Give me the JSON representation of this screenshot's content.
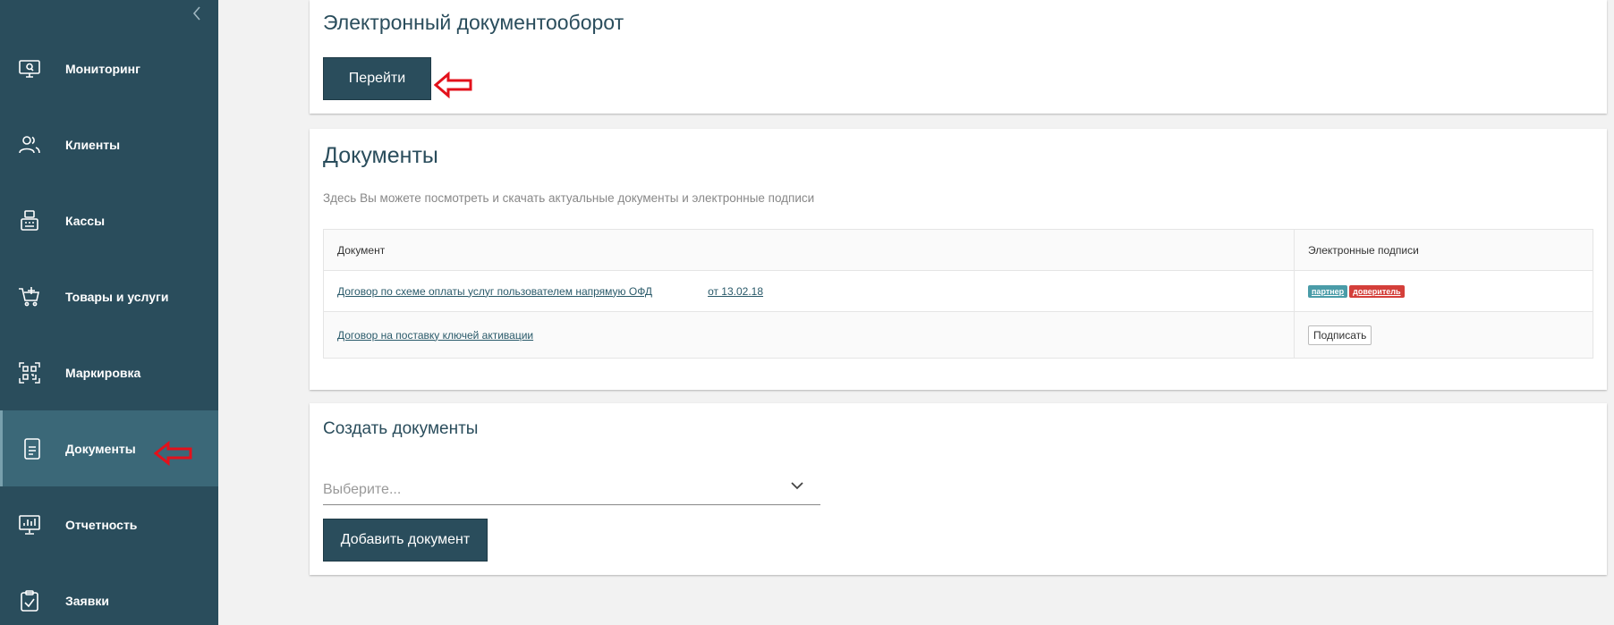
{
  "sidebar": {
    "items": [
      {
        "label": "Мониторинг",
        "icon": "monitor-icon"
      },
      {
        "label": "Клиенты",
        "icon": "users-icon"
      },
      {
        "label": "Кассы",
        "icon": "cash-register-icon"
      },
      {
        "label": "Товары и услуги",
        "icon": "cart-icon"
      },
      {
        "label": "Маркировка",
        "icon": "qr-code-icon"
      },
      {
        "label": "Документы",
        "icon": "document-icon"
      },
      {
        "label": "Отчетность",
        "icon": "chart-board-icon"
      },
      {
        "label": "Заявки",
        "icon": "clipboard-check-icon"
      }
    ],
    "active_item": "Документы"
  },
  "edo": {
    "title": "Электронный документооборот",
    "button": "Перейти"
  },
  "documents": {
    "title": "Документы",
    "description": "Здесь Вы можете посмотреть и скачать актуальные документы и электронные подписи",
    "columns": [
      "Документ",
      "Электронные подписи"
    ],
    "rows": [
      {
        "doc_part1": "Договор по схеме оплаты услуг пользователем напрямую ОФД",
        "doc_part2": "от 13.02.18",
        "badges": [
          "партнер",
          "доверитель"
        ]
      },
      {
        "doc": "Договор на поставку ключей активации",
        "action": "Подписать"
      }
    ]
  },
  "create": {
    "title": "Создать документы",
    "select_placeholder": "Выберите...",
    "button": "Добавить документ"
  },
  "colors": {
    "sidebar_bg": "#2a4d5c",
    "sidebar_active": "#3b6878",
    "primary": "#2a4d5c",
    "annotation_arrow": "#e3111b",
    "badge_teal": "#4a9ca8",
    "badge_red": "#d43f3a"
  }
}
